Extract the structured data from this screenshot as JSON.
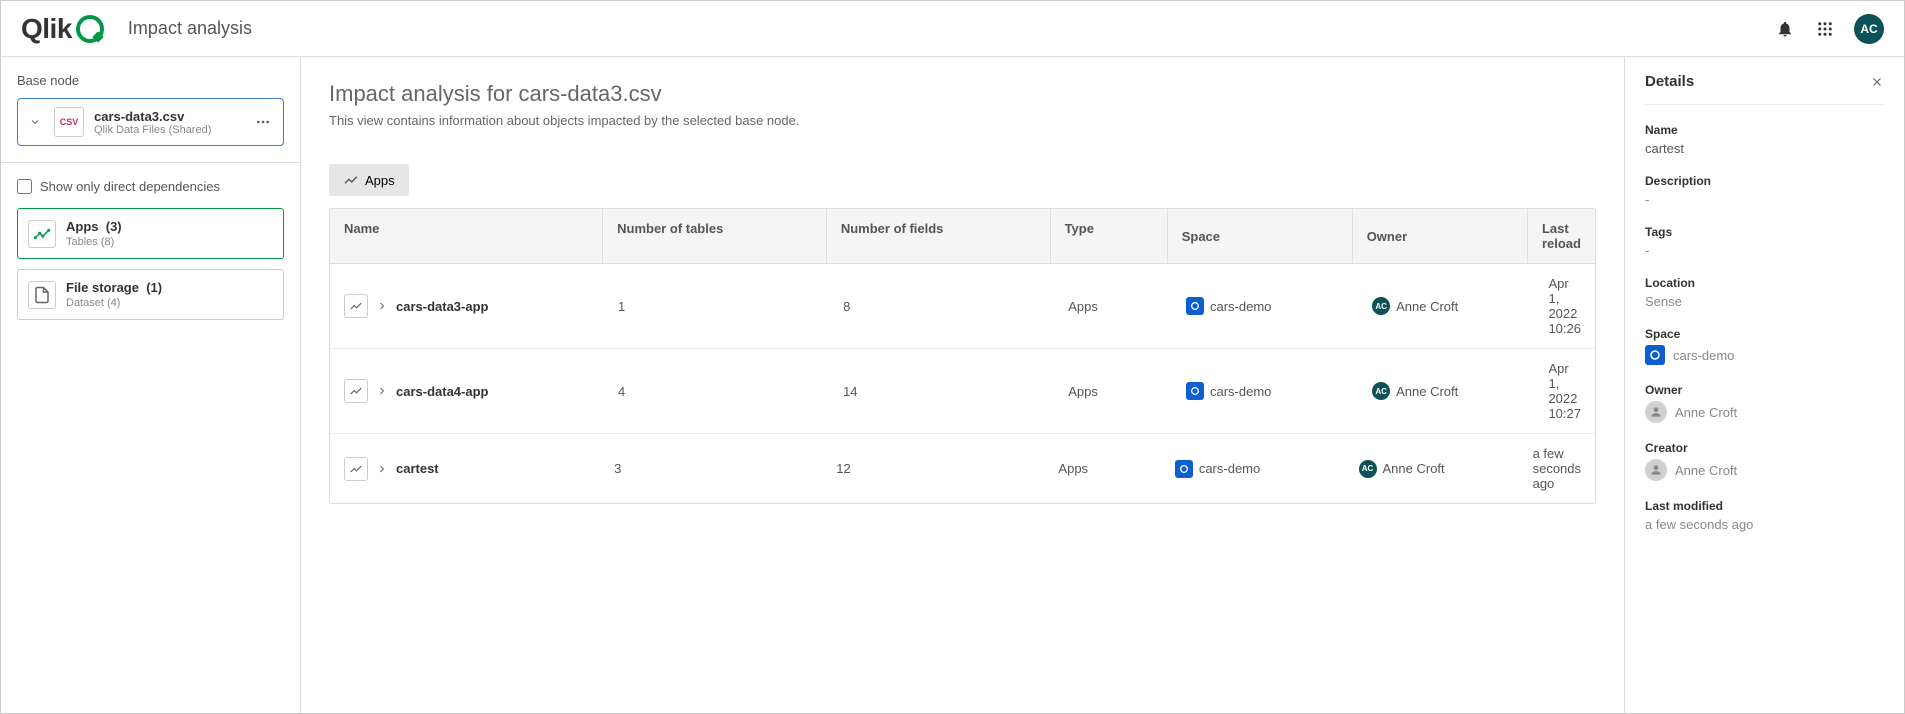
{
  "topbar": {
    "logo_text": "Qlik",
    "page_label": "Impact analysis",
    "avatar_initials": "AC"
  },
  "sidebar": {
    "base_node_label": "Base node",
    "base_node": {
      "file_type": "CSV",
      "title": "cars-data3.csv",
      "subtitle": "Qlik Data Files (Shared)"
    },
    "checkbox_label": "Show only direct dependencies",
    "categories": [
      {
        "title": "Apps",
        "count": "(3)",
        "sub": "Tables (8)",
        "icon": "apps"
      },
      {
        "title": "File storage",
        "count": "(1)",
        "sub": "Dataset (4)",
        "icon": "file"
      }
    ]
  },
  "content": {
    "title": "Impact analysis for cars-data3.csv",
    "subtitle": "This view contains information about objects impacted by the selected base node.",
    "tab_label": "Apps",
    "columns": {
      "name": "Name",
      "num_tables": "Number of tables",
      "num_fields": "Number of fields",
      "type": "Type",
      "space": "Space",
      "owner": "Owner",
      "last_reload": "Last reload"
    },
    "rows": [
      {
        "name": "cars-data3-app",
        "num_tables": "1",
        "num_fields": "8",
        "type": "Apps",
        "space": "cars-demo",
        "owner": "Anne Croft",
        "owner_initials": "AC",
        "last_reload": "Apr 1, 2022 10:26"
      },
      {
        "name": "cars-data4-app",
        "num_tables": "4",
        "num_fields": "14",
        "type": "Apps",
        "space": "cars-demo",
        "owner": "Anne Croft",
        "owner_initials": "AC",
        "last_reload": "Apr 1, 2022 10:27"
      },
      {
        "name": "cartest",
        "num_tables": "3",
        "num_fields": "12",
        "type": "Apps",
        "space": "cars-demo",
        "owner": "Anne Croft",
        "owner_initials": "AC",
        "last_reload": "a few seconds ago"
      }
    ]
  },
  "details": {
    "panel_title": "Details",
    "name_label": "Name",
    "name_value": "cartest",
    "description_label": "Description",
    "description_value": "-",
    "tags_label": "Tags",
    "tags_value": "-",
    "location_label": "Location",
    "location_value": "Sense",
    "space_label": "Space",
    "space_value": "cars-demo",
    "owner_label": "Owner",
    "owner_value": "Anne Croft",
    "creator_label": "Creator",
    "creator_value": "Anne Croft",
    "last_modified_label": "Last modified",
    "last_modified_value": "a few seconds ago"
  }
}
